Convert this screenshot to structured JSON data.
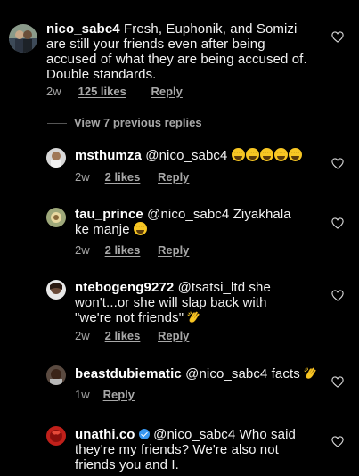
{
  "comments": [
    {
      "username": "nico_sabc4",
      "text": "Fresh, Euphonik, and Somizi are still your friends even after being accused of what they are being accused of. Double standards.",
      "time": "2w",
      "likes": "125 likes",
      "reply": "Reply"
    },
    {
      "username": "msthumza",
      "text": "@nico_sabc4",
      "time": "2w",
      "likes": "2 likes",
      "reply": "Reply",
      "emoji_count": 5
    },
    {
      "username": "tau_prince",
      "text": "@nico_sabc4 Ziyakhala ke manje",
      "time": "2w",
      "likes": "2 likes",
      "reply": "Reply"
    },
    {
      "username": "ntebogeng9272",
      "text": "@tsatsi_ltd she won't...or she will slap back with \"we're not friends\"",
      "time": "2w",
      "likes": "2 likes",
      "reply": "Reply"
    },
    {
      "username": "beastdubiematic",
      "text": "@nico_sabc4 facts",
      "time": "1w",
      "reply": "Reply"
    },
    {
      "username": "unathi.co",
      "text": "@nico_sabc4 Who said they're my friends? We're also not friends you and I.",
      "verified": true
    }
  ],
  "view_previous": "View 7 previous replies",
  "icons": {
    "heart": "heart-outline-icon",
    "emoji_laugh": "tears-of-joy-emoji",
    "clap": "clapping-hands-emoji",
    "verified": "verified-badge-icon"
  },
  "colors": {
    "background": "#000000",
    "text": "#f2f2f2",
    "meta": "#a8a8a8",
    "verified": "#3897f0"
  }
}
